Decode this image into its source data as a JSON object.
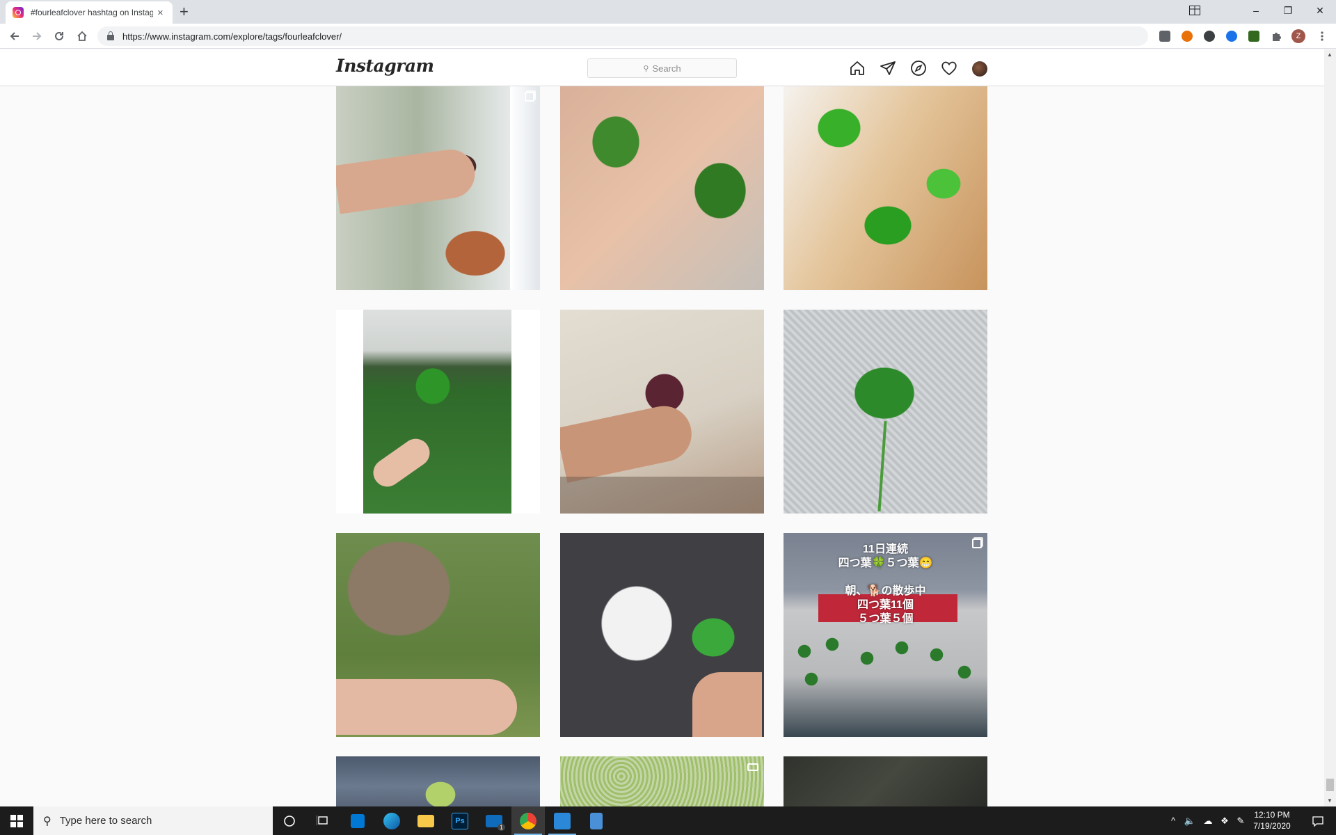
{
  "browser": {
    "tab_title": "#fourleafclover hashtag on Instag",
    "tab_close": "×",
    "new_tab": "+",
    "url": "https://www.instagram.com/explore/tags/fourleafclover/",
    "window_controls": {
      "minimize": "–",
      "restore": "❐",
      "close": "✕"
    },
    "profile_initial": "Z"
  },
  "instagram": {
    "logo": "Instagram",
    "search_placeholder": "Search",
    "nav_icons": [
      "home-icon",
      "direct-icon",
      "explore-icon",
      "activity-icon",
      "profile-avatar"
    ]
  },
  "posts": [
    {
      "subject": "hand holding four-leaf clovers by window",
      "badge": "multi"
    },
    {
      "subject": "two four-leaf clovers in palm",
      "badge": ""
    },
    {
      "subject": "clovers in glass of water",
      "badge": ""
    },
    {
      "subject": "hand holding clover in field",
      "badge": ""
    },
    {
      "subject": "dark purple four-leaf clover in hand",
      "badge": ""
    },
    {
      "subject": "three-leaf clover on textured surface",
      "badge": ""
    },
    {
      "subject": "pug sniffing clover in hand",
      "badge": ""
    },
    {
      "subject": "dog with four-leaf clover",
      "badge": ""
    },
    {
      "subject": "clovers collection with Japanese text",
      "badge": "multi",
      "overlay_lines": [
        "11日連続",
        "四つ葉🍀５つ葉😁",
        "",
        "朝、🐕の散歩中",
        "四つ葉11個",
        "５つ葉５個"
      ]
    },
    {
      "subject": "clover on denim",
      "badge": ""
    },
    {
      "subject": "clover field",
      "badge": "video"
    },
    {
      "subject": "dark blurred photo",
      "badge": ""
    }
  ],
  "taskbar": {
    "search_placeholder": "Type here to search",
    "mail_badge": "1",
    "time": "12:10 PM",
    "date": "7/19/2020"
  }
}
